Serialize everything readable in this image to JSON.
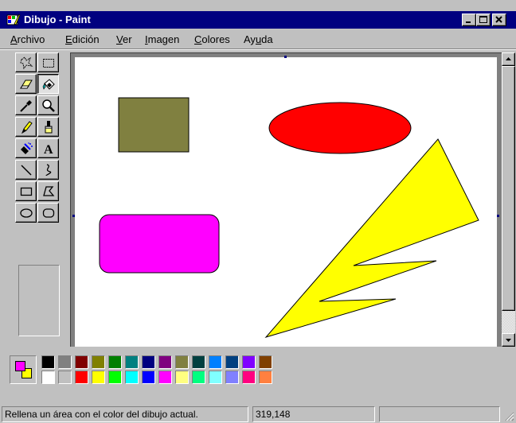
{
  "window": {
    "title": "Dibujo - Paint",
    "icon": "paint-app-icon",
    "controls": [
      "minimize-icon",
      "maximize-icon",
      "close-icon"
    ]
  },
  "menu": [
    {
      "label": "Archivo",
      "accel": "A",
      "rest": "rchivo"
    },
    {
      "label": "Edición",
      "accel": "E",
      "rest": "dición"
    },
    {
      "label": "Ver",
      "accel": "V",
      "rest": "er"
    },
    {
      "label": "Imagen",
      "accel": "I",
      "rest": "magen"
    },
    {
      "label": "Colores",
      "accel": "C",
      "rest": "olores"
    },
    {
      "label": "Ayuda",
      "accel": "u",
      "pre": "Ay",
      "rest": "da"
    }
  ],
  "tools": [
    "free-form-select-icon",
    "rect-select-icon",
    "eraser-icon",
    "fill-bucket-icon",
    "color-picker-icon",
    "magnifier-icon",
    "pencil-icon",
    "brush-icon",
    "airbrush-icon",
    "text-icon",
    "line-icon",
    "curve-icon",
    "rectangle-icon",
    "polygon-icon",
    "ellipse-icon",
    "rounded-rectangle-icon"
  ],
  "selected_tool": "fill-bucket-icon",
  "text_tool_glyph": "A",
  "canvas": {
    "shapes": [
      {
        "type": "rectangle",
        "fill": "#808040"
      },
      {
        "type": "ellipse",
        "fill": "#ff0000"
      },
      {
        "type": "rounded-rectangle",
        "fill": "#ff00ff"
      },
      {
        "type": "polygon",
        "fill": "#ffff00"
      }
    ]
  },
  "colors": {
    "foreground": "#ff00ff",
    "background": "#ffff00",
    "palette_top": [
      "#000000",
      "#808080",
      "#800000",
      "#808000",
      "#008000",
      "#008080",
      "#000080",
      "#800080",
      "#808040",
      "#004040",
      "#0080ff",
      "#004080",
      "#8000ff",
      "#804000"
    ],
    "palette_bottom": [
      "#ffffff",
      "#c0c0c0",
      "#ff0000",
      "#ffff00",
      "#00ff00",
      "#00ffff",
      "#0000ff",
      "#ff00ff",
      "#ffff80",
      "#00ff80",
      "#80ffff",
      "#8080ff",
      "#ff0080",
      "#ff8040"
    ]
  },
  "status": {
    "message": "Rellena un área con el color del dibujo actual.",
    "coordinates": "319,148"
  }
}
